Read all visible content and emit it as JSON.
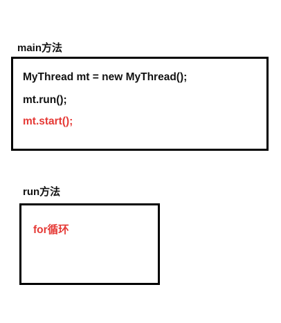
{
  "main_section": {
    "title": "main方法",
    "lines": [
      {
        "text": "MyThread mt = new MyThread();",
        "color": "#111111"
      },
      {
        "text": "mt.run();",
        "color": "#111111"
      },
      {
        "text": "mt.start();",
        "color": "#e53935"
      }
    ]
  },
  "run_section": {
    "title": "run方法",
    "lines": [
      {
        "text": "for循环",
        "color": "#e53935"
      }
    ]
  }
}
